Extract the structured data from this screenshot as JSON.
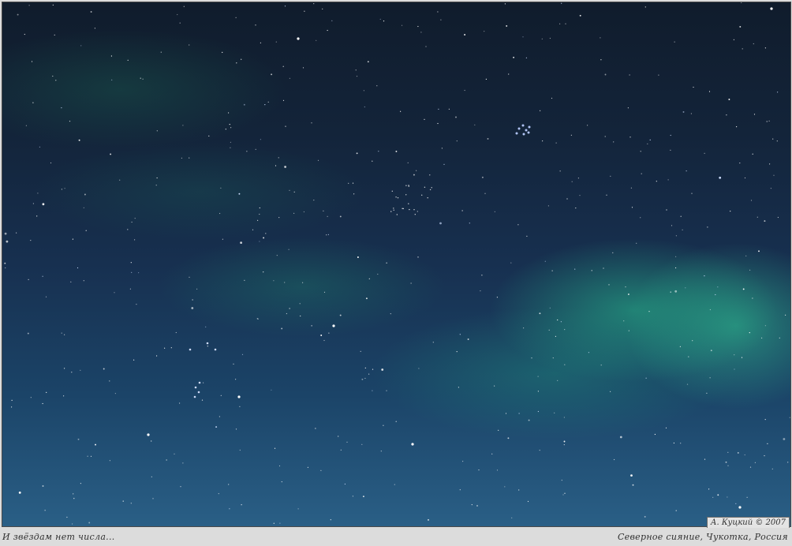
{
  "photo": {
    "subject": "northern lights over starry sky",
    "colors": {
      "sky_top": "#101c2c",
      "sky_bottom": "#2a5f86",
      "aurora": "#28be8c"
    }
  },
  "caption": {
    "left": "И звёздам нет числа...",
    "right": "Северное сияние, Чукотка, Россия",
    "copyright": "А. Куцкий © 2007"
  }
}
